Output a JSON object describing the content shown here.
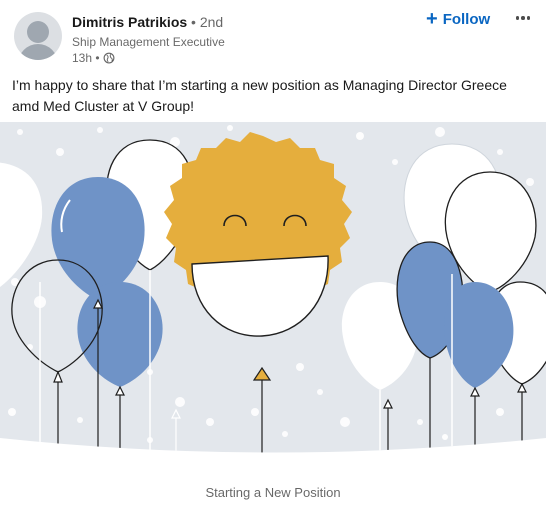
{
  "post": {
    "author": {
      "name": "Dimitris Patrikios",
      "degree": "• 2nd",
      "headline": "Ship Management Executive",
      "time": "13h •",
      "visibility_icon": "globe-icon"
    },
    "follow_label": "Follow",
    "follow_icon": "plus-icon",
    "more_icon": "more-options-icon",
    "text": "I’m happy to share that I’m starting a new position as Managing Director Greece amd Med Cluster at V Group!",
    "card": {
      "illustration": "smiling sun balloon with blue and white balloons",
      "caption": "Starting a New Position"
    }
  },
  "colors": {
    "accent": "#0a66c2",
    "banner_bg": "#e3e7ec",
    "balloon_blue": "#6f93c7",
    "balloon_white": "#ffffff",
    "sun": "#e5ae3d"
  }
}
